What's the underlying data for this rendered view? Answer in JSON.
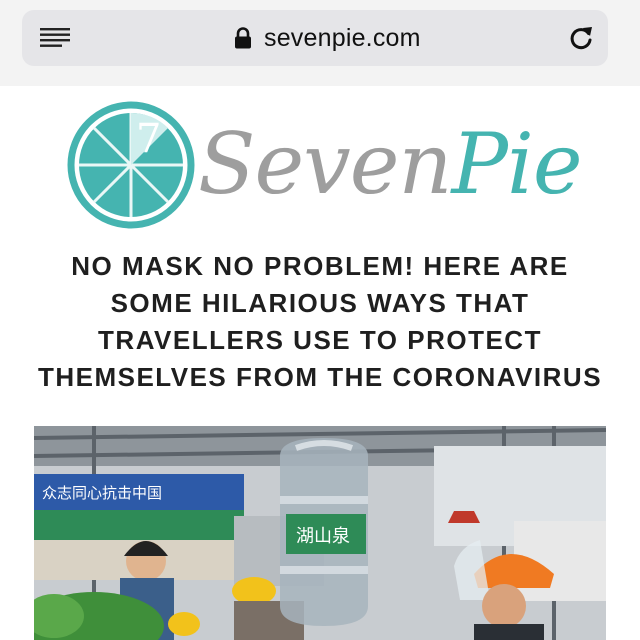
{
  "browser": {
    "url": "sevenpie.com",
    "icons": [
      "menu-icon",
      "lock-icon",
      "reload-icon"
    ]
  },
  "logo": {
    "text_part1": "Seven",
    "text_part2": "Pie",
    "badge_number": "7",
    "colors": {
      "gray": "#9e9e9e",
      "teal": "#45b4b0"
    }
  },
  "article": {
    "headline": "NO MASK NO PROBLEM! HERE ARE SOME HILARIOUS WAYS THAT TRAVELLERS USE TO PROTECT THEMSELVES FROM THE CORONAVIRUS"
  },
  "photo": {
    "jug_label": "湖山泉",
    "signboard": "众志同心抗击中国"
  }
}
